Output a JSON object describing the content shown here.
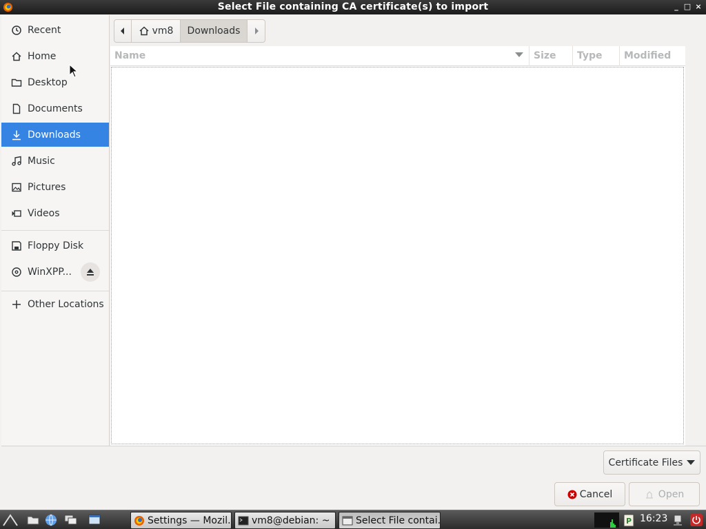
{
  "window": {
    "title": "Select File containing CA certificate(s) to import",
    "controls": [
      "_",
      "□",
      "×"
    ]
  },
  "sidebar": {
    "items": [
      {
        "label": "Recent",
        "icon": "recent-icon"
      },
      {
        "label": "Home",
        "icon": "home-icon"
      },
      {
        "label": "Desktop",
        "icon": "folder-icon"
      },
      {
        "label": "Documents",
        "icon": "document-icon"
      },
      {
        "label": "Downloads",
        "icon": "download-icon",
        "active": true
      },
      {
        "label": "Music",
        "icon": "music-icon"
      },
      {
        "label": "Pictures",
        "icon": "pictures-icon"
      },
      {
        "label": "Videos",
        "icon": "video-icon"
      }
    ],
    "devices": [
      {
        "label": "Floppy Disk",
        "icon": "floppy-icon"
      },
      {
        "label": "WinXPP...",
        "icon": "disc-icon"
      }
    ],
    "other": {
      "label": "Other Locations",
      "icon": "plus-icon"
    }
  },
  "pathbar": {
    "home_label": "vm8",
    "current_label": "Downloads"
  },
  "columns": {
    "name": "Name",
    "size": "Size",
    "type": "Type",
    "modified": "Modified"
  },
  "filter": {
    "selected": "Certificate Files"
  },
  "buttons": {
    "cancel": "Cancel",
    "open": "Open"
  },
  "taskbar": {
    "tasks": [
      {
        "label": "Settings — Mozil..."
      },
      {
        "label": "vm8@debian: ~"
      },
      {
        "label": "Select File contai..."
      }
    ],
    "clock": "16:23"
  },
  "colors": {
    "accent": "#3584e4",
    "cancel_red": "#cc0000"
  }
}
